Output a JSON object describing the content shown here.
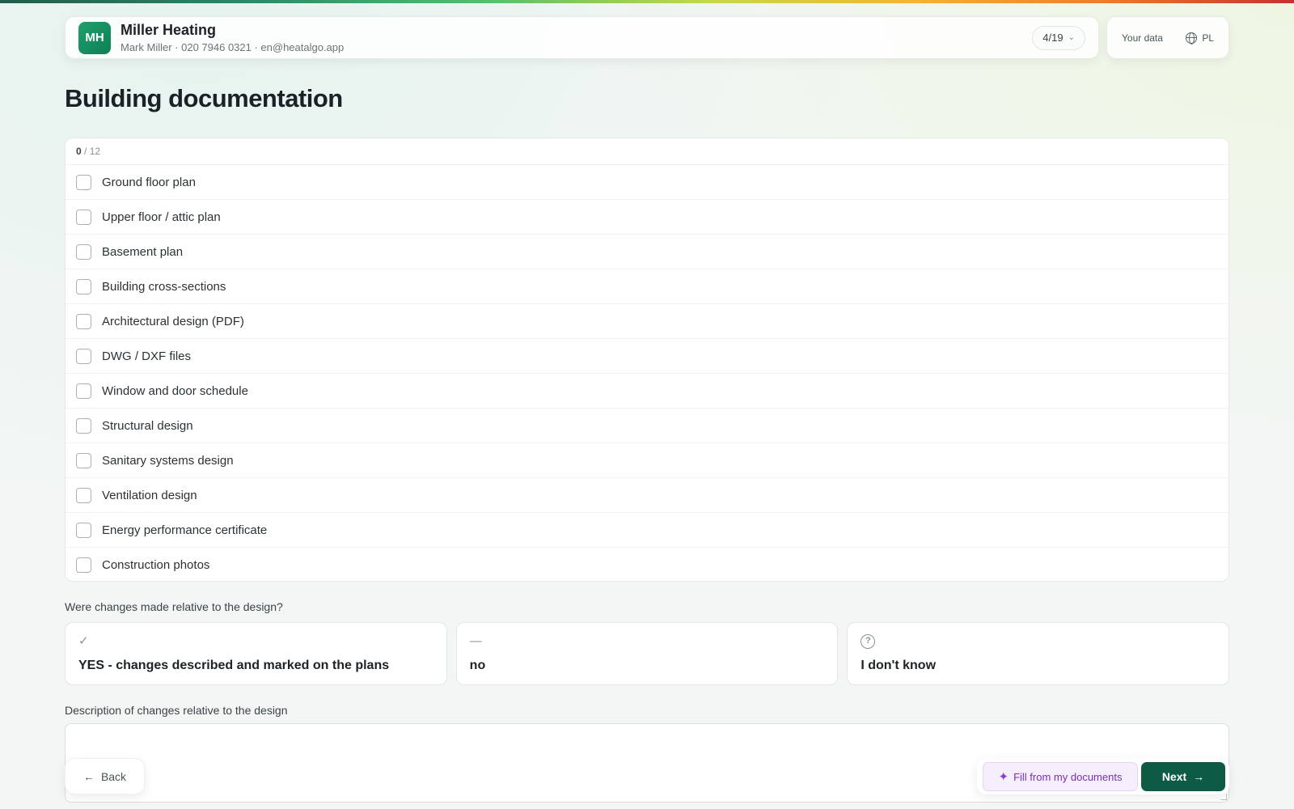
{
  "header": {
    "avatar_initials": "MH",
    "company_name": "Miller Heating",
    "contact": "Mark Miller · 020 7946 0321 · en@heatalgo.app",
    "step": "4/19"
  },
  "top_right": {
    "your_data": "Your data",
    "language": "PL"
  },
  "page": {
    "title": "Building documentation"
  },
  "checklist": {
    "checked": "0",
    "total": "/ 12",
    "items": [
      "Ground floor plan",
      "Upper floor / attic plan",
      "Basement plan",
      "Building cross-sections",
      "Architectural design (PDF)",
      "DWG / DXF files",
      "Window and door schedule",
      "Structural design",
      "Sanitary systems design",
      "Ventilation design",
      "Energy performance certificate",
      "Construction photos"
    ]
  },
  "question": {
    "label": "Were changes made relative to the design?",
    "options": [
      {
        "icon": "check-icon",
        "label": "YES - changes described and marked on the plans"
      },
      {
        "icon": "dash-icon",
        "label": "no"
      },
      {
        "icon": "question-circle-icon",
        "label": "I don't know"
      }
    ]
  },
  "description": {
    "label": "Description of changes relative to the design",
    "value": ""
  },
  "actions": {
    "back": "Back",
    "fill": "Fill from my documents",
    "next": "Next"
  },
  "colors": {
    "brand_green": "#0d5a45",
    "avatar_green": "#1fa06a",
    "fill_purple": "#7a2fb5"
  }
}
